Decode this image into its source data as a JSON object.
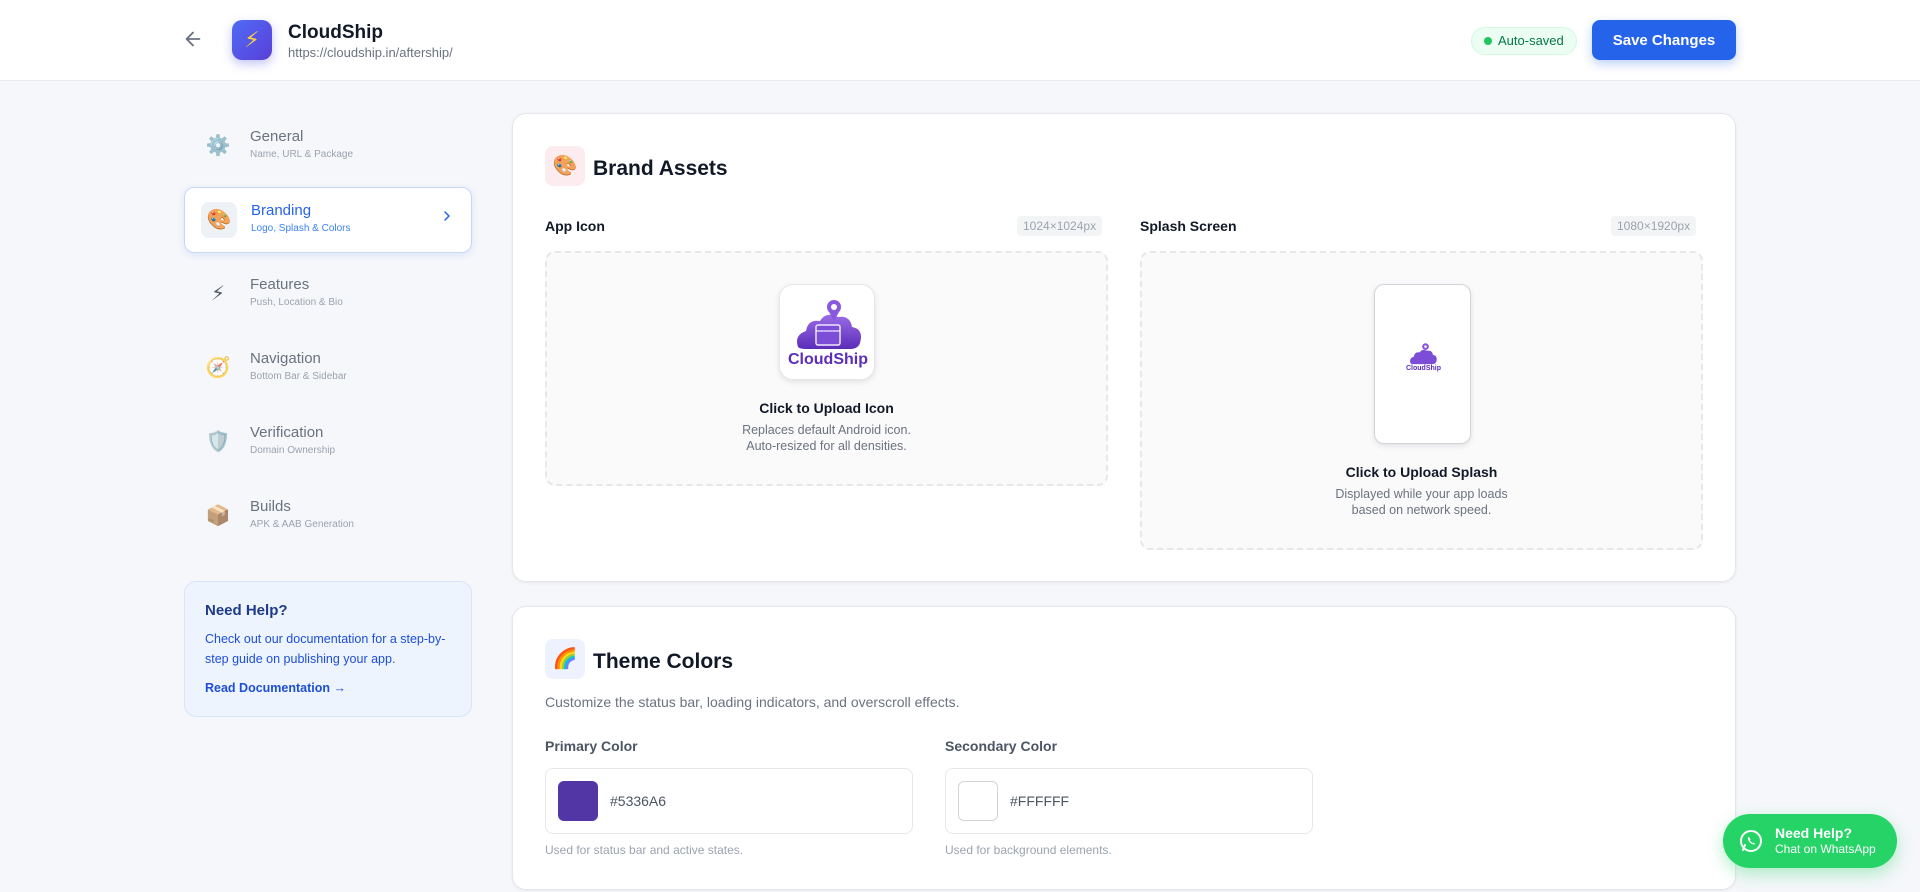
{
  "header": {
    "back_icon": "arrow-left-icon",
    "app_name": "CloudShip",
    "app_url": "https://cloudship.in/aftership/",
    "autosave_label": "Auto-saved",
    "save_label": "Save Changes"
  },
  "sidebar": {
    "items": [
      {
        "label": "General",
        "sub": "Name, URL & Package",
        "icon": "gear-icon",
        "glyph": "⚙️"
      },
      {
        "label": "Branding",
        "sub": "Logo, Splash & Colors",
        "icon": "palette-icon",
        "glyph": "🎨"
      },
      {
        "label": "Features",
        "sub": "Push, Location & Bio",
        "icon": "lightning-icon",
        "glyph": "⚡"
      },
      {
        "label": "Navigation",
        "sub": "Bottom Bar & Sidebar",
        "icon": "compass-icon",
        "glyph": "🧭"
      },
      {
        "label": "Verification",
        "sub": "Domain Ownership",
        "icon": "shield-icon",
        "glyph": "🛡️"
      },
      {
        "label": "Builds",
        "sub": "APK & AAB Generation",
        "icon": "package-icon",
        "glyph": "📦"
      }
    ],
    "active": "Branding"
  },
  "help": {
    "title": "Need Help?",
    "text": "Check out our documentation for a step-by-step guide on publishing your app.",
    "link": "Read Documentation →"
  },
  "brand_assets": {
    "title": "Brand Assets",
    "app_icon": {
      "label": "App Icon",
      "dim": "1024×1024px",
      "upload_title": "Click to Upload Icon",
      "upload_sub1": "Replaces default Android icon.",
      "upload_sub2": "Auto-resized for all densities.",
      "logo_text": "CloudShip"
    },
    "splash": {
      "label": "Splash Screen",
      "dim": "1080×1920px",
      "upload_title": "Click to Upload Splash",
      "upload_sub1": "Displayed while your app loads",
      "upload_sub2": "based on network speed.",
      "logo_text": "CloudShip"
    }
  },
  "theme": {
    "title": "Theme Colors",
    "description": "Customize the status bar, loading indicators, and overscroll effects.",
    "primary": {
      "label": "Primary Color",
      "value": "#5336A6",
      "hint": "Used for status bar and active states."
    },
    "secondary": {
      "label": "Secondary Color",
      "value": "#FFFFFF",
      "hint": "Used for background elements."
    }
  },
  "whatsapp": {
    "title": "Need Help?",
    "sub": "Chat on WhatsApp"
  },
  "colors": {
    "accent": "#2563eb",
    "brand_purple": "#5336A6",
    "whatsapp_green": "#25d366"
  }
}
